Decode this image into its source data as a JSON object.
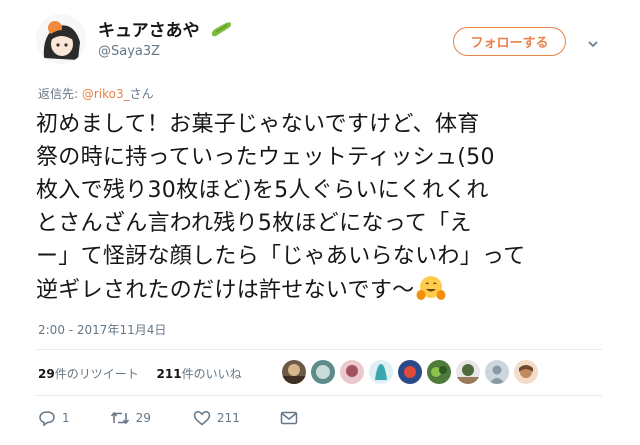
{
  "user": {
    "display_name": "キュアさあや",
    "handle": "@Saya3Z"
  },
  "follow_button": {
    "label": "フォローする"
  },
  "reply": {
    "prefix": "返信先: ",
    "mention": "@riko3_",
    "suffix": "さん"
  },
  "tweet": {
    "lines": [
      "初めまして！お菓子じゃないですけど、体育",
      "祭の時に持っていったウェットティッシュ(50",
      "枚入で残り30枚ほど)を5人ぐらいにくれくれ",
      "とさんざん言われ残り5枚ほどになって「え",
      "ー」て怪訝な顔したら「じゃあいらないわ」って",
      "逆ギレされたのだけは許せないです～"
    ],
    "emoji": "hugging-face-emoji",
    "timestamp": "2:00 - 2017年11月4日"
  },
  "stats": {
    "retweets_count": "29",
    "retweets_label": "件のリツイート",
    "likes_count": "211",
    "likes_label": "件のいいね"
  },
  "actions": {
    "reply_count": "1",
    "retweet_count": "29",
    "like_count": "211"
  },
  "colors": {
    "accent": "#e8824b",
    "name_emoji_green": "#7cbd3a",
    "muted": "#657786"
  },
  "likers": [
    "avatar-1",
    "avatar-2",
    "avatar-3",
    "avatar-4",
    "avatar-5",
    "avatar-6",
    "avatar-7",
    "avatar-8",
    "avatar-9"
  ]
}
